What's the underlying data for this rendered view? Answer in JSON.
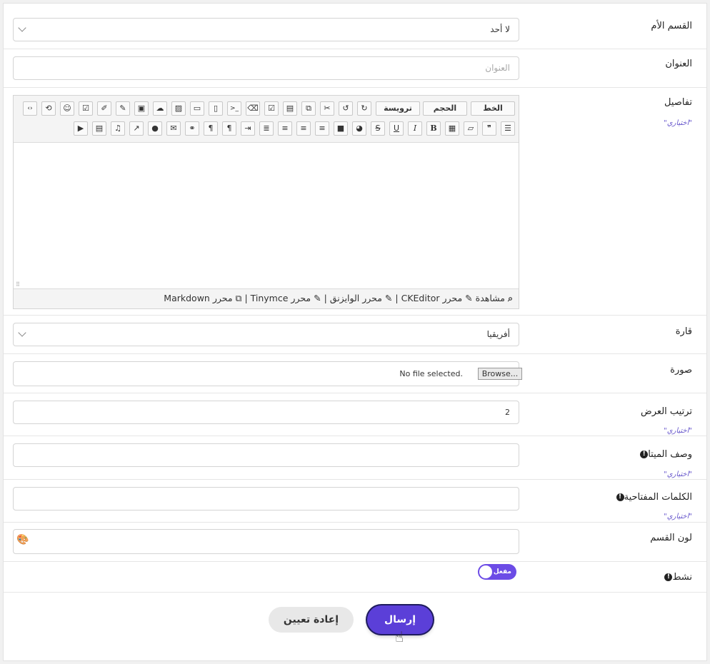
{
  "form": {
    "parent": {
      "label": "القسم الأم",
      "value": "لا أحد"
    },
    "title": {
      "label": "العنوان",
      "placeholder": "العنوان"
    },
    "details": {
      "label": "تفاصيل",
      "optional": "\"اختياري\"",
      "toolbar": {
        "font": "الخط",
        "size": "الحجم",
        "heading": "ترويسة"
      },
      "footer": {
        "preview": "مشاهدة",
        "ckeditor": "محرر CKEditor",
        "wysiwyg": "محرر الوايزنق",
        "tinymce": "محرر Tinymce",
        "markdown": "محرر Markdown",
        "sep": "|"
      }
    },
    "continent": {
      "label": "قارة",
      "value": "أفريقيا"
    },
    "image": {
      "label": "صورة",
      "button": "Browse...",
      "status": "No file selected."
    },
    "order": {
      "label": "ترتيب العرض",
      "value": "2",
      "optional": "\"اختياري\""
    },
    "meta": {
      "label": "وصف الميتا",
      "optional": "\"اختياري\""
    },
    "keywords": {
      "label": "الكلمات المفتاحية",
      "optional": "\"اختياري\""
    },
    "color": {
      "label": "لون القسم"
    },
    "active": {
      "label": "نشط",
      "state": "مفعل"
    }
  },
  "actions": {
    "submit": "إرسال",
    "reset": "إعادة تعيين"
  }
}
